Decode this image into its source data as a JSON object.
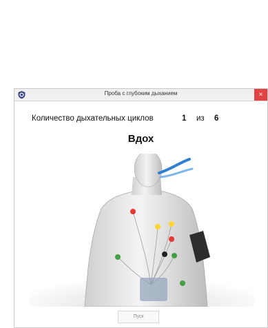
{
  "window": {
    "title": "Проба с глубоким дыханием",
    "close_glyph": "×",
    "app_icon": "app-shield-icon"
  },
  "counter": {
    "label": "Количество дыхательных циклов",
    "current": "1",
    "separator": "из",
    "total": "6"
  },
  "phase": "Вдох",
  "illustration": {
    "subject": "torso-with-ecg-electrodes",
    "airflow_color": "#2f7fd1",
    "electrode_colors": [
      "#e53935",
      "#fdd835",
      "#43a047",
      "#212121"
    ]
  },
  "start_button": {
    "label": "Пуск",
    "enabled": false
  }
}
